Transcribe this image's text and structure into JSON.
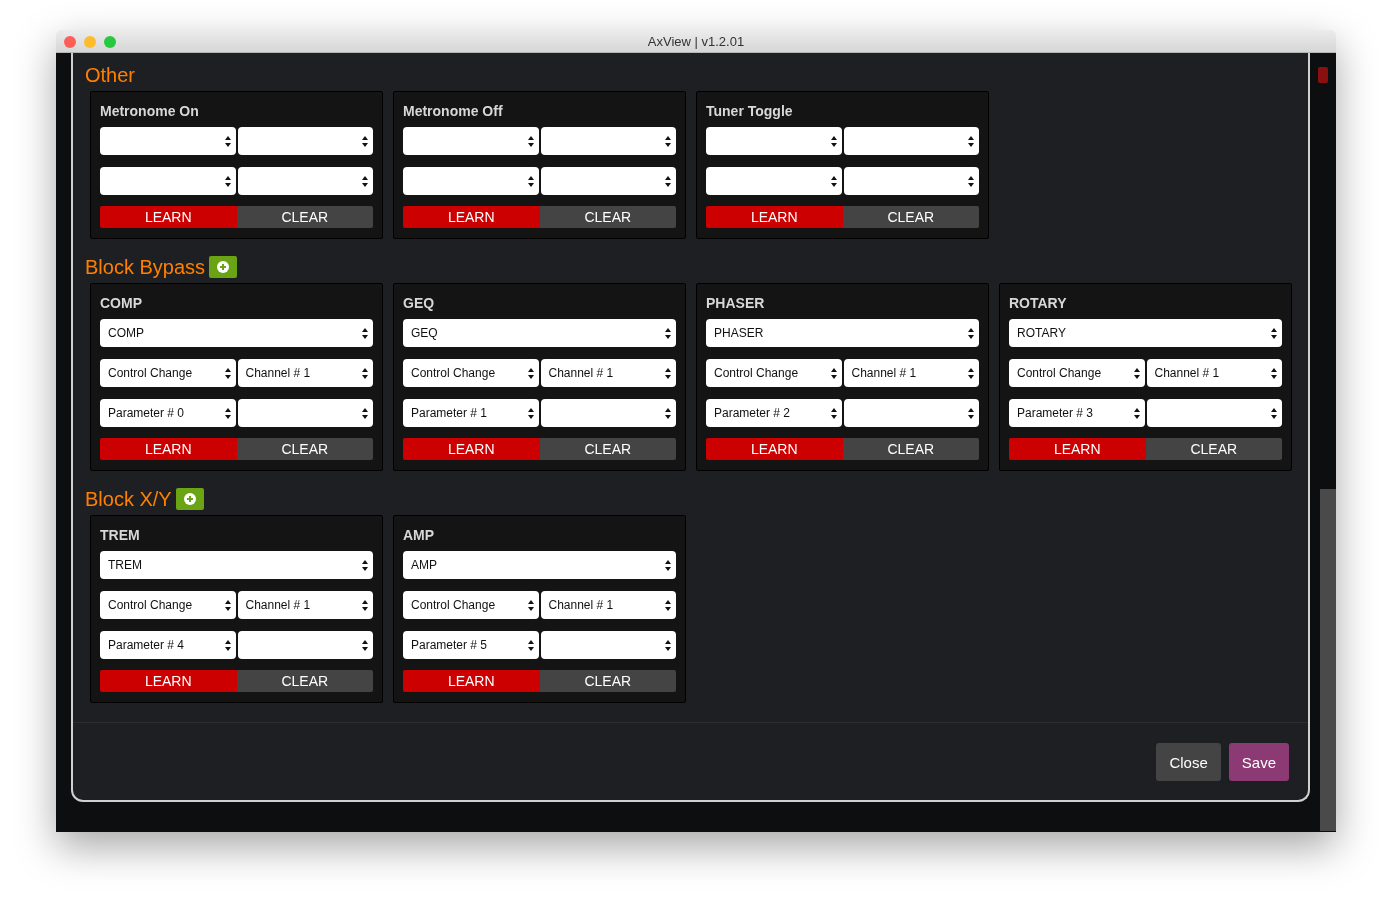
{
  "window": {
    "title": "AxView | v1.2.01"
  },
  "sections": [
    {
      "title": "Other",
      "add_button": false,
      "cards": [
        {
          "title": "Metronome On",
          "rows": [
            [
              null,
              null
            ],
            [
              null,
              null
            ]
          ],
          "buttons": [
            {
              "label": "LEARN",
              "kind": "learn"
            },
            {
              "label": "CLEAR",
              "kind": "clear"
            }
          ]
        },
        {
          "title": "Metronome Off",
          "rows": [
            [
              null,
              null
            ],
            [
              null,
              null
            ]
          ],
          "buttons": [
            {
              "label": "LEARN",
              "kind": "learn"
            },
            {
              "label": "CLEAR",
              "kind": "clear"
            }
          ]
        },
        {
          "title": "Tuner Toggle",
          "rows": [
            [
              null,
              null
            ],
            [
              null,
              null
            ]
          ],
          "buttons": [
            {
              "label": "LEARN",
              "kind": "learn"
            },
            {
              "label": "CLEAR",
              "kind": "clear"
            }
          ]
        }
      ]
    },
    {
      "title": "Block Bypass",
      "add_button": true,
      "cards": [
        {
          "title": "COMP",
          "rows": [
            [
              "COMP"
            ],
            [
              "Control Change",
              "Channel # 1"
            ],
            [
              "Parameter # 0",
              null
            ]
          ],
          "buttons": [
            {
              "label": "LEARN",
              "kind": "learn"
            },
            {
              "label": "CLEAR",
              "kind": "clear"
            }
          ]
        },
        {
          "title": "GEQ",
          "rows": [
            [
              "GEQ"
            ],
            [
              "Control Change",
              "Channel # 1"
            ],
            [
              "Parameter # 1",
              null
            ]
          ],
          "buttons": [
            {
              "label": "LEARN",
              "kind": "learn"
            },
            {
              "label": "CLEAR",
              "kind": "clear"
            }
          ]
        },
        {
          "title": "PHASER",
          "rows": [
            [
              "PHASER"
            ],
            [
              "Control Change",
              "Channel # 1"
            ],
            [
              "Parameter # 2",
              null
            ]
          ],
          "buttons": [
            {
              "label": "LEARN",
              "kind": "learn"
            },
            {
              "label": "CLEAR",
              "kind": "clear"
            }
          ]
        },
        {
          "title": "ROTARY",
          "rows": [
            [
              "ROTARY"
            ],
            [
              "Control Change",
              "Channel # 1"
            ],
            [
              "Parameter # 3",
              null
            ]
          ],
          "buttons": [
            {
              "label": "LEARN",
              "kind": "learn"
            },
            {
              "label": "CLEAR",
              "kind": "clear"
            }
          ]
        }
      ]
    },
    {
      "title": "Block X/Y",
      "add_button": true,
      "cards": [
        {
          "title": "TREM",
          "rows": [
            [
              "TREM"
            ],
            [
              "Control Change",
              "Channel # 1"
            ],
            [
              "Parameter # 4",
              null
            ]
          ],
          "buttons": [
            {
              "label": "LEARN",
              "kind": "learn"
            },
            {
              "label": "CLEAR",
              "kind": "clear"
            }
          ]
        },
        {
          "title": "AMP",
          "rows": [
            [
              "AMP"
            ],
            [
              "Control Change",
              "Channel # 1"
            ],
            [
              "Parameter # 5",
              null
            ]
          ],
          "buttons": [
            {
              "label": "LEARN",
              "kind": "learn"
            },
            {
              "label": "CLEAR",
              "kind": "clear"
            }
          ]
        }
      ]
    }
  ],
  "footer_buttons": [
    {
      "label": "Close",
      "kind": "close"
    },
    {
      "label": "Save",
      "kind": "save"
    }
  ]
}
